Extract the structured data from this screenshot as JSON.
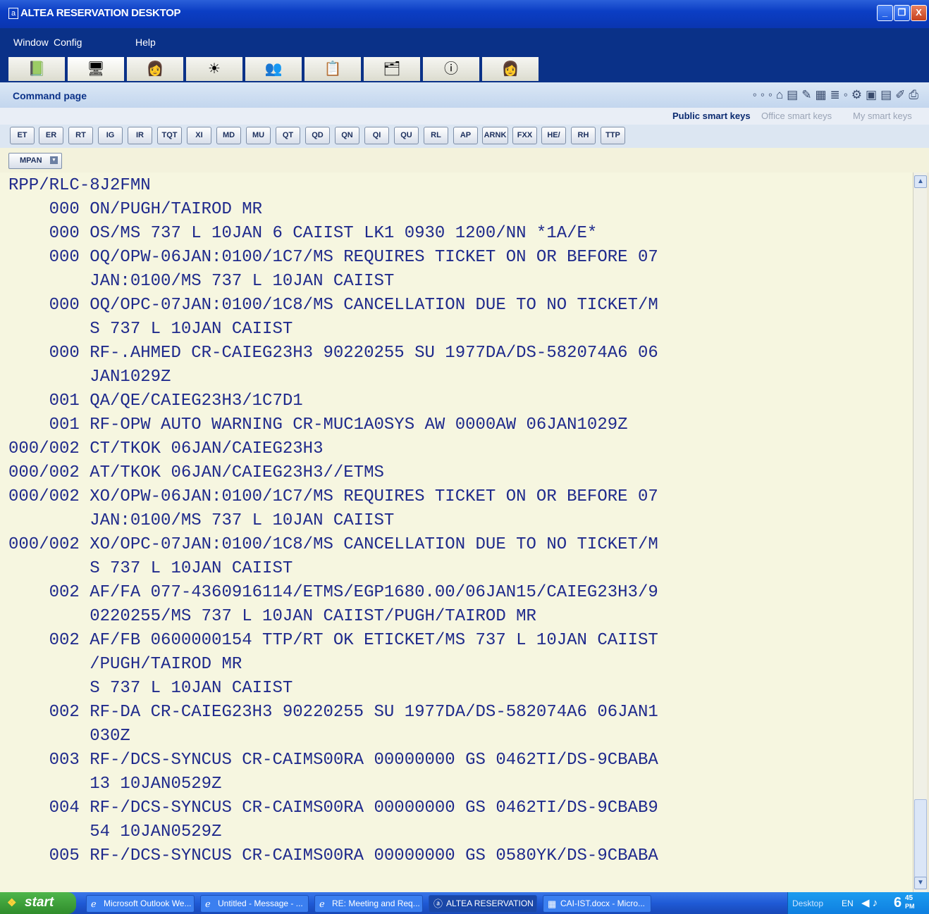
{
  "window": {
    "title": "ALTEA RESERVATION DESKTOP",
    "app_icon": "a",
    "minimize": "_",
    "maximize": "❐",
    "close": "X"
  },
  "menu": {
    "window": "Window",
    "config": "Config",
    "help": "Help"
  },
  "toolbar_icons": [
    "book-icon",
    "terminal-icon",
    "agent-icon",
    "sun-icon",
    "people-icon",
    "clipboard-icon",
    "files-icon",
    "info-icon",
    "agent-icon"
  ],
  "command_page": {
    "label": "Command page"
  },
  "smart_tabs": {
    "public": "Public smart keys",
    "office": "Office smart keys",
    "my": "My smart keys"
  },
  "smart_keys": [
    "ET",
    "ER",
    "RT",
    "IG",
    "IR",
    "TQT",
    "XI",
    "MD",
    "MU",
    "QT",
    "QD",
    "QN",
    "QI",
    "QU",
    "RL",
    "AP",
    "ARNK",
    "FXX",
    "HE/",
    "RH",
    "TTP"
  ],
  "mpan": {
    "label": "MPAN"
  },
  "screen_lines": [
    "RPP/RLC-8J2FMN",
    "    000 ON/PUGH/TAIROD MR",
    "    000 OS/MS 737 L 10JAN 6 CAIIST LK1 0930 1200/NN *1A/E*",
    "    000 OQ/OPW-06JAN:0100/1C7/MS REQUIRES TICKET ON OR BEFORE 07",
    "        JAN:0100/MS 737 L 10JAN CAIIST",
    "    000 OQ/OPC-07JAN:0100/1C8/MS CANCELLATION DUE TO NO TICKET/M",
    "        S 737 L 10JAN CAIIST",
    "    000 RF-.AHMED CR-CAIEG23H3 90220255 SU 1977DA/DS-582074A6 06",
    "        JAN1029Z",
    "    001 QA/QE/CAIEG23H3/1C7D1",
    "    001 RF-OPW AUTO WARNING CR-MUC1A0SYS AW 0000AW 06JAN1029Z",
    "000/002 CT/TKOK 06JAN/CAIEG23H3",
    "000/002 AT/TKOK 06JAN/CAIEG23H3//ETMS",
    "000/002 XO/OPW-06JAN:0100/1C7/MS REQUIRES TICKET ON OR BEFORE 07",
    "        JAN:0100/MS 737 L 10JAN CAIIST",
    "000/002 XO/OPC-07JAN:0100/1C8/MS CANCELLATION DUE TO NO TICKET/M",
    "        S 737 L 10JAN CAIIST",
    "    002 AF/FA 077-4360916114/ETMS/EGP1680.00/06JAN15/CAIEG23H3/9",
    "        0220255/MS 737 L 10JAN CAIIST/PUGH/TAIROD MR",
    "    002 AF/FB 0600000154 TTP/RT OK ETICKET/MS 737 L 10JAN CAIIST",
    "        /PUGH/TAIROD MR",
    "        S 737 L 10JAN CAIIST",
    "    002 RF-DA CR-CAIEG23H3 90220255 SU 1977DA/DS-582074A6 06JAN1",
    "        030Z",
    "    003 RF-/DCS-SYNCUS CR-CAIMS00RA 00000000 GS 0462TI/DS-9CBABA",
    "        13 10JAN0529Z",
    "    004 RF-/DCS-SYNCUS CR-CAIMS00RA 00000000 GS 0462TI/DS-9CBAB9",
    "        54 10JAN0529Z",
    "    005 RF-/DCS-SYNCUS CR-CAIMS00RA 00000000 GS 0580YK/DS-9CBABA"
  ],
  "taskbar": {
    "start": "start",
    "tasks": [
      {
        "label": "Microsoft Outlook We...",
        "icon": "ie-icon"
      },
      {
        "label": "Untitled - Message - ...",
        "icon": "ie-icon"
      },
      {
        "label": "RE: Meeting and Req...",
        "icon": "ie-icon"
      },
      {
        "label": "ALTEA RESERVATION...",
        "icon": "altea-icon"
      },
      {
        "label": "CAI-IST.docx - Micro...",
        "icon": "word-icon"
      }
    ],
    "tray": {
      "desktop": "Desktop",
      "lang": "EN",
      "clock_hour": "6",
      "clock_min": "45",
      "clock_ampm": "PM"
    }
  }
}
